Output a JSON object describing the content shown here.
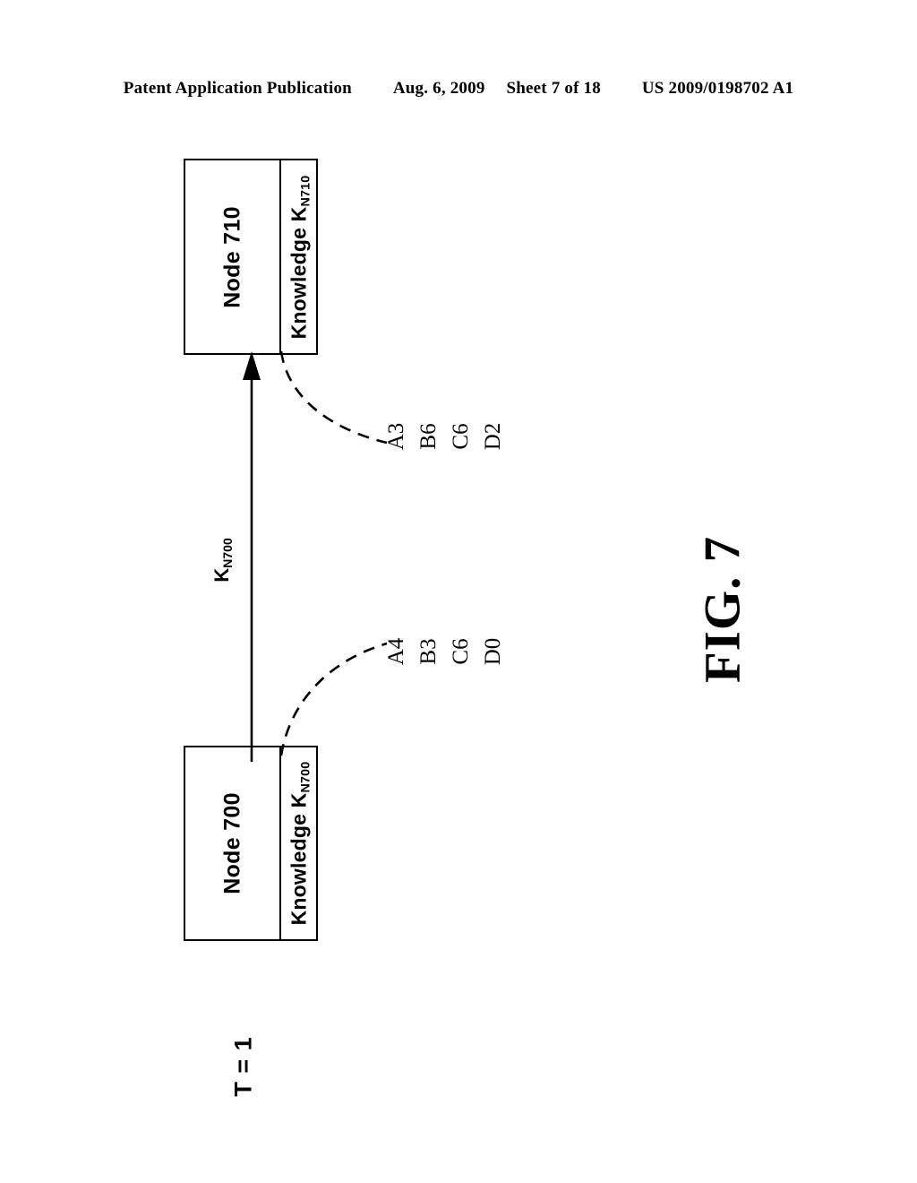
{
  "header": {
    "publication": "Patent Application Publication",
    "date": "Aug. 6, 2009",
    "sheet": "Sheet 7 of 18",
    "patent_number": "US 2009/0198702 A1"
  },
  "figure": {
    "caption": "FIG. 7",
    "time_label": "T = 1"
  },
  "nodes": [
    {
      "id": "node-710",
      "title": "Node 710",
      "knowledge_label": "Knowledge K",
      "knowledge_subscript": "N710",
      "values": [
        "A3",
        "B6",
        "C6",
        "D2"
      ]
    },
    {
      "id": "node-700",
      "title": "Node 700",
      "knowledge_label": "Knowledge K",
      "knowledge_subscript": "N700",
      "values": [
        "A4",
        "B3",
        "C6",
        "D0"
      ]
    }
  ],
  "arrow": {
    "label": "K",
    "label_subscript": "N700",
    "direction": "node-700-to-node-710"
  },
  "colors": {
    "ink": "#000000",
    "paper": "#ffffff"
  }
}
